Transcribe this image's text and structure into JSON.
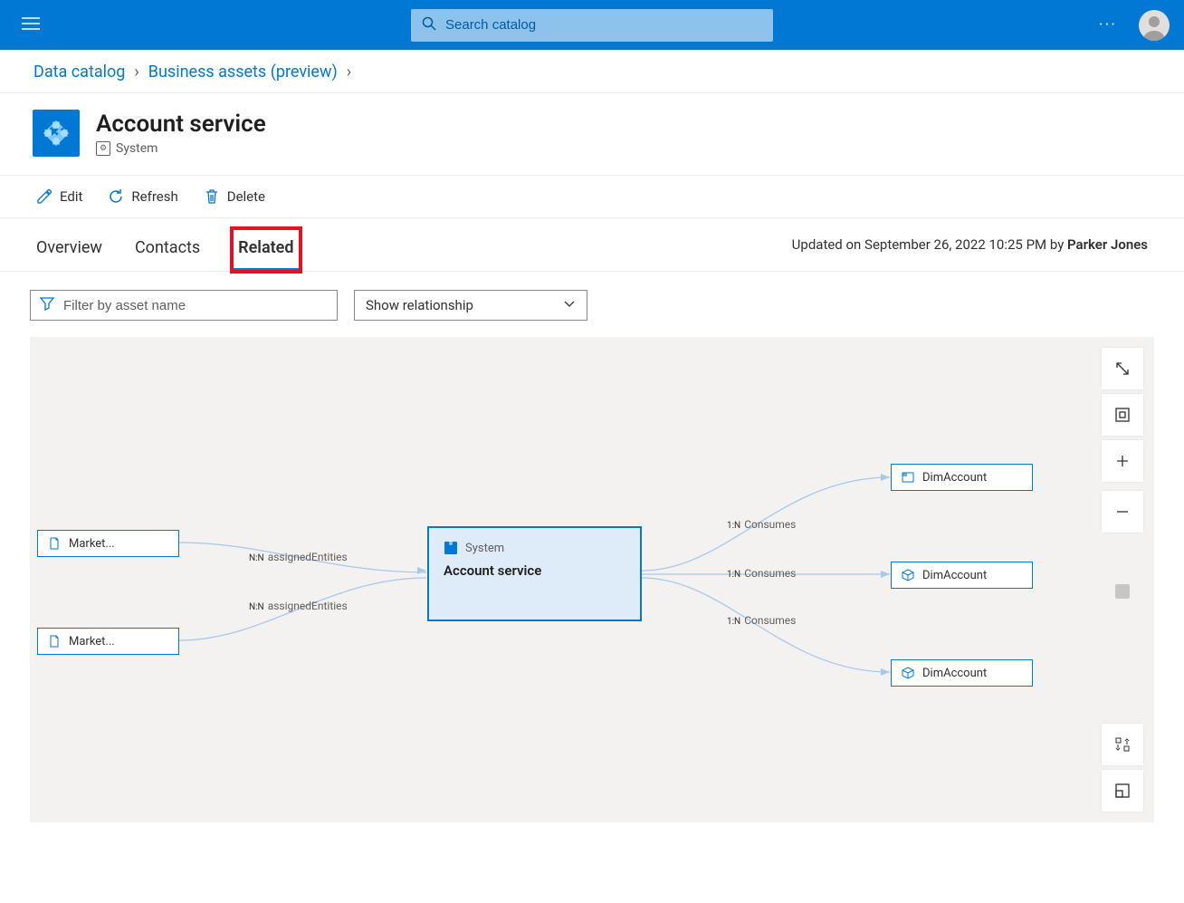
{
  "topbar": {
    "search_placeholder": "Search catalog"
  },
  "breadcrumb": {
    "item1": "Data catalog",
    "item2": "Business assets (preview)"
  },
  "asset": {
    "title": "Account service",
    "type": "System"
  },
  "actions": {
    "edit": "Edit",
    "refresh": "Refresh",
    "delete": "Delete"
  },
  "tabs": {
    "overview": "Overview",
    "contacts": "Contacts",
    "related": "Related"
  },
  "updated": {
    "prefix": "Updated on September 26, 2022 10:25 PM by ",
    "author": "Parker Jones"
  },
  "filter": {
    "placeholder": "Filter by asset name",
    "show_relationship": "Show relationship"
  },
  "graph": {
    "market1": "Market...",
    "market2": "Market...",
    "assigned1": "assignedEntities",
    "assigned2": "assignedEntities",
    "nn": "N:N",
    "main_type": "System",
    "main_title": "Account service",
    "oneN": "1:N",
    "consumes": "Consumes",
    "dim": "DimAccount"
  }
}
